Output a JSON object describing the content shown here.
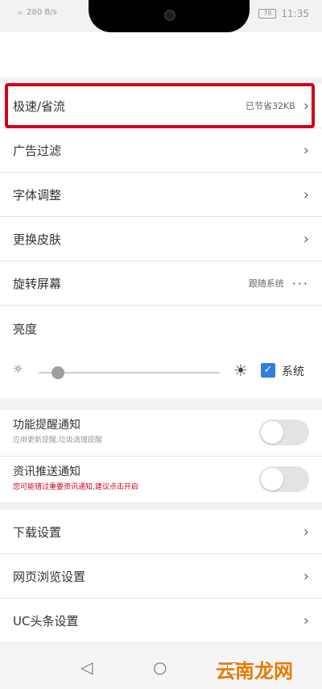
{
  "status": {
    "signal": "ᵢₗₗ",
    "speed": "280 B/s",
    "battery": "78",
    "time": "11:35"
  },
  "list1": [
    {
      "label": "极速/省流",
      "value": "已节省32KB",
      "trail": "›"
    },
    {
      "label": "广告过滤",
      "value": "",
      "trail": "›"
    },
    {
      "label": "字体调整",
      "value": "",
      "trail": "›"
    },
    {
      "label": "更换皮肤",
      "value": "",
      "trail": "›"
    },
    {
      "label": "旋转屏幕",
      "value": "跟随系统",
      "trail": "···"
    }
  ],
  "brightness": {
    "title": "亮度",
    "level": 0.07,
    "system_label": "系统",
    "system_checked": true
  },
  "notifications": [
    {
      "title": "功能提醒通知",
      "subtitle": "应用更新提醒,垃圾清理提醒",
      "subtitle_red": false,
      "enabled": false
    },
    {
      "title": "资讯推送通知",
      "subtitle": "您可能错过重要资讯通知,建议点击开启",
      "subtitle_red": true,
      "enabled": false
    }
  ],
  "list2": [
    {
      "label": "下载设置",
      "trail": "›"
    },
    {
      "label": "网页浏览设置",
      "trail": "›"
    },
    {
      "label": "UC头条设置",
      "trail": "›"
    }
  ],
  "watermark": "云南龙网",
  "icons": {
    "back": "◁",
    "home": "○",
    "recent": "□",
    "sun_small": "☼",
    "sun_large": "☀",
    "check": "✓"
  },
  "colors": {
    "accent": "#2f7de1",
    "highlight": "#d0021b"
  }
}
